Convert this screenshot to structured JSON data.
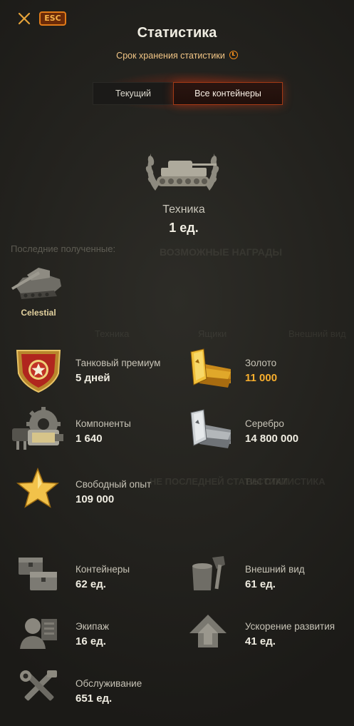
{
  "header": {
    "title": "Статистика",
    "subtitle": "Срок хранения статистики",
    "esc_label": "ESC"
  },
  "tabs": [
    {
      "label": "Текущий",
      "active": false
    },
    {
      "label": "Все контейнеры",
      "active": true
    }
  ],
  "vehicles": {
    "label": "Техника",
    "count": "1 ед."
  },
  "recent": {
    "label": "Последние полученные:",
    "items": [
      {
        "name": "Celestial",
        "icon": "tank-icon"
      }
    ]
  },
  "background_ghost": {
    "possible_rewards": "ВОЗМОЖНЫЕ НАГРАДЫ",
    "tanks": "Техника",
    "crew": "Ящики",
    "skins": "Внешний вид",
    "stats": "НЕ ПОСЛЕДНЕЙ СТАТИСТИКИ",
    "stats2": "ВЫ СТАТИСТИКА"
  },
  "rewards": [
    {
      "label": "Танковый премиум",
      "value": "5 дней",
      "icon": "premium-account-icon"
    },
    {
      "label": "Золото",
      "value": "11 000",
      "value_color": "#f7ae2d",
      "icon": "gold-bars-icon"
    },
    {
      "label": "Компоненты",
      "value": "1 640",
      "icon": "components-icon"
    },
    {
      "label": "Серебро",
      "value": "14 800 000",
      "icon": "silver-bars-icon"
    },
    {
      "label": "Свободный опыт",
      "value": "109 000",
      "icon": "free-xp-star-icon"
    },
    {
      "label": "Контейнеры",
      "value": "62 ед.",
      "icon": "containers-icon"
    },
    {
      "label": "Внешний вид",
      "value": "61 ед.",
      "icon": "paint-bucket-icon"
    },
    {
      "label": "Экипаж",
      "value": "16 ед.",
      "icon": "crew-icon"
    },
    {
      "label": "Ускорение развития",
      "value": "41 ед.",
      "icon": "acceleration-arrow-icon"
    },
    {
      "label": "Обслуживание",
      "value": "651 ед.",
      "icon": "maintenance-tools-icon"
    }
  ],
  "colors": {
    "accent": "#e07b19",
    "gold_text": "#f7ae2d",
    "subtitle_text": "#f2c686",
    "tab_active_border": "#a33a16"
  }
}
